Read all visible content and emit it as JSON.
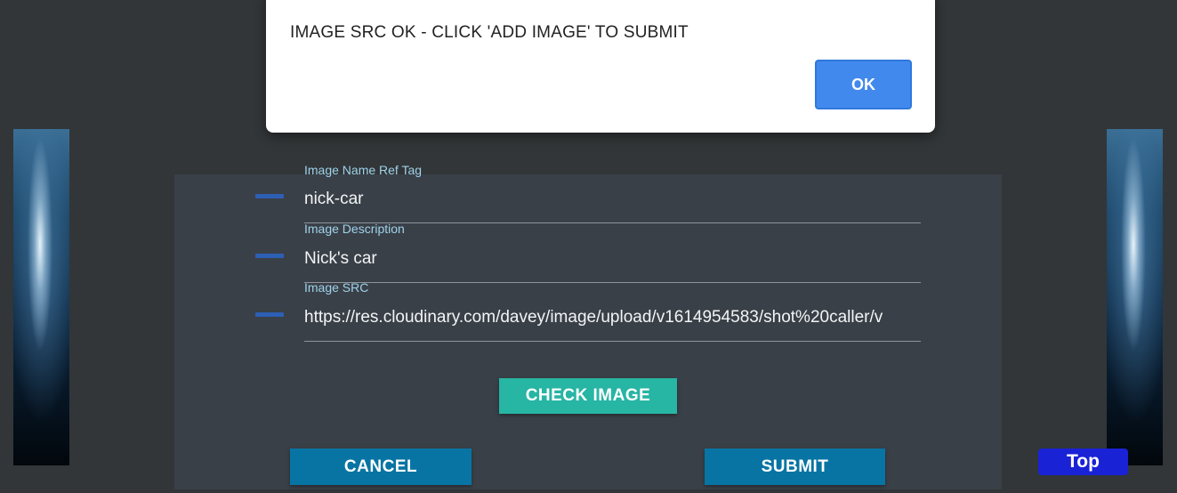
{
  "alert": {
    "message": "IMAGE SRC OK - CLICK 'ADD IMAGE' TO SUBMIT",
    "ok_label": "OK"
  },
  "form": {
    "fields": [
      {
        "label": "Image Name Ref Tag",
        "value": "nick-car"
      },
      {
        "label": "Image Description",
        "value": "Nick's car"
      },
      {
        "label": "Image SRC",
        "value": "https://res.cloudinary.com/davey/image/upload/v1614954583/shot%20caller/v"
      }
    ],
    "check_label": "CHECK IMAGE",
    "cancel_label": "CANCEL",
    "submit_label": "SUBMIT"
  },
  "top_label": "Top",
  "colors": {
    "page_bg": "#323638",
    "panel_bg": "#3a4048",
    "label_text": "#9fd2ea",
    "check_button": "#27b5a4",
    "action_button": "#0874a3",
    "top_button": "#1a22d6",
    "ok_button": "#4189ec"
  }
}
